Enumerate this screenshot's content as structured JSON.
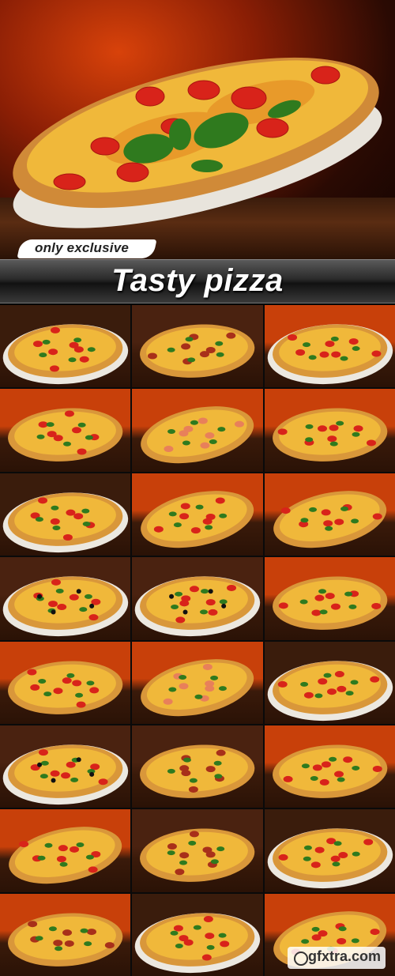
{
  "hero": {
    "badge_label": "only exclusive",
    "title": "Tasty pizza"
  },
  "gallery": {
    "columns": 3,
    "rows": 8,
    "thumbnails": [
      {
        "bg": "#3a1c0c",
        "style": "plate"
      },
      {
        "bg": "#4a2210",
        "style": "pepperoni"
      },
      {
        "bg": "#c8400a",
        "style": "plate"
      },
      {
        "bg": "#c8400a",
        "style": "flat"
      },
      {
        "bg": "#c8400a",
        "style": "salmon"
      },
      {
        "bg": "#c8400a",
        "style": "flat"
      },
      {
        "bg": "#3a1c0c",
        "style": "plate"
      },
      {
        "bg": "#c8400a",
        "style": "oval"
      },
      {
        "bg": "#c8400a",
        "style": "oval"
      },
      {
        "bg": "#4a2210",
        "style": "olive"
      },
      {
        "bg": "#4a2210",
        "style": "olive"
      },
      {
        "bg": "#c8400a",
        "style": "flat"
      },
      {
        "bg": "#c8400a",
        "style": "flat"
      },
      {
        "bg": "#c8400a",
        "style": "salmon"
      },
      {
        "bg": "#3a1c0c",
        "style": "plate"
      },
      {
        "bg": "#4a2210",
        "style": "olive"
      },
      {
        "bg": "#4a2210",
        "style": "pepperoni"
      },
      {
        "bg": "#c8400a",
        "style": "flat"
      },
      {
        "bg": "#c8400a",
        "style": "oval"
      },
      {
        "bg": "#4a2210",
        "style": "pepperoni"
      },
      {
        "bg": "#3a1c0c",
        "style": "plate"
      },
      {
        "bg": "#c8400a",
        "style": "pepperoni"
      },
      {
        "bg": "#3a1c0c",
        "style": "plate"
      },
      {
        "bg": "#c8400a",
        "style": "oval"
      }
    ]
  },
  "watermark": {
    "text": "gfxtra.com"
  },
  "colors": {
    "background": "#000000",
    "crust": "#d9973a",
    "cheese": "#f0b83a",
    "tomato": "#d8231a",
    "basil": "#2f7a1e",
    "accent_orange": "#c8400a"
  }
}
